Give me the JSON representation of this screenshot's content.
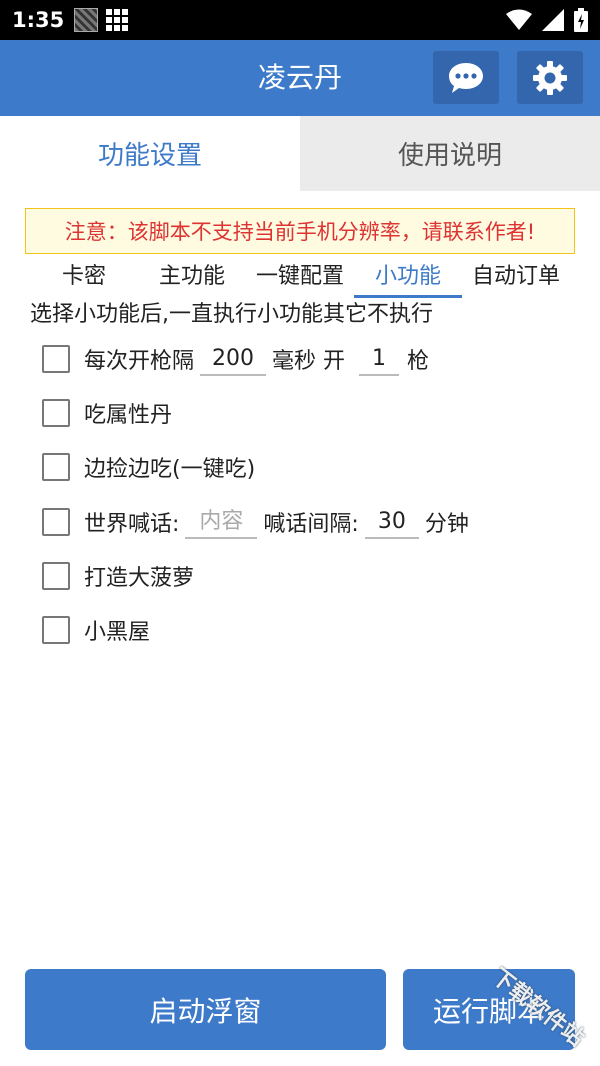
{
  "status_bar": {
    "time": "1:35"
  },
  "app_bar": {
    "title": "凌云丹",
    "chat_icon": "chat-bubble-icon",
    "settings_icon": "gear-icon"
  },
  "main_tabs": [
    {
      "label": "功能设置",
      "active": true
    },
    {
      "label": "使用说明",
      "active": false
    }
  ],
  "warning": "注意：该脚本不支持当前手机分辨率，请联系作者!",
  "sub_tabs": [
    {
      "label": "卡密",
      "active": false
    },
    {
      "label": "主功能",
      "active": false
    },
    {
      "label": "一键配置",
      "active": false
    },
    {
      "label": "小功能",
      "active": true
    },
    {
      "label": "自动订单",
      "active": false
    }
  ],
  "description": "选择小功能后,一直执行小功能其它不执行",
  "options": {
    "fire": {
      "label_a": "每次开枪隔",
      "interval": "200",
      "label_b": "毫秒 开",
      "count": "1",
      "label_c": "枪",
      "checked": false
    },
    "eat_attr": {
      "label": "吃属性丹",
      "checked": false
    },
    "pick_eat": {
      "label": "边捡边吃(一键吃)",
      "checked": false
    },
    "shout": {
      "label_a": "世界喊话:",
      "content_placeholder": "内容",
      "label_b": "喊话间隔:",
      "interval": "30",
      "label_c": "分钟",
      "checked": false
    },
    "pineapple": {
      "label": "打造大菠萝",
      "checked": false
    },
    "black_house": {
      "label": "小黑屋",
      "checked": false
    }
  },
  "buttons": {
    "float_window": "启动浮窗",
    "run_script": "运行脚本"
  },
  "watermark": "下载软件站",
  "colors": {
    "primary": "#3d7ac9",
    "warning_text": "#dd3333",
    "warning_bg": "#fffbe0"
  }
}
